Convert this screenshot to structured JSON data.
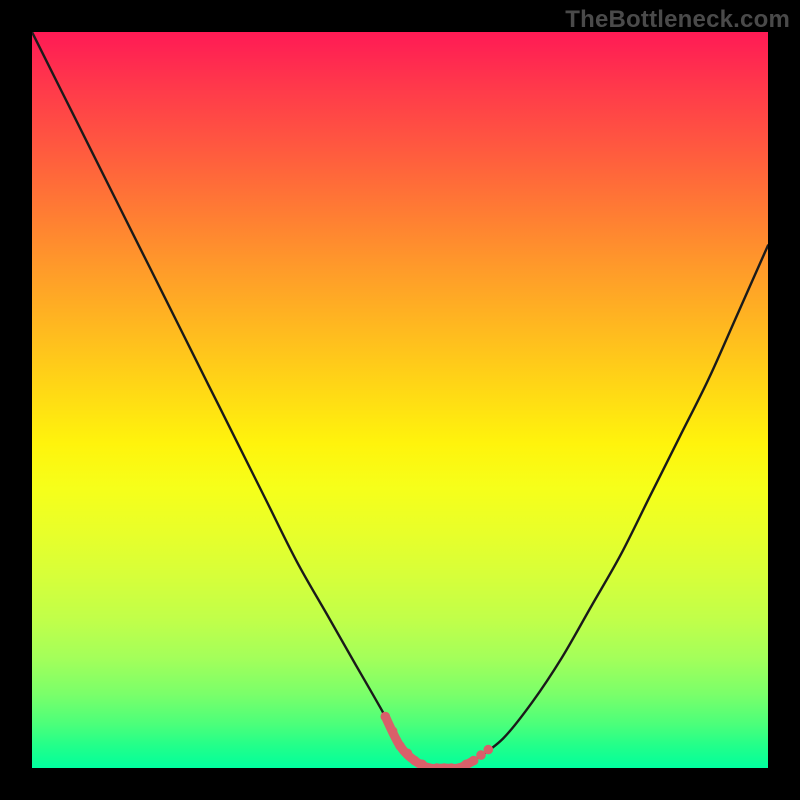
{
  "watermark": "TheBottleneck.com",
  "colors": {
    "frame": "#000000",
    "curve_stroke": "#1a1a1a",
    "lowband_marker": "#d9606a",
    "gradient_top": "#ff1a55",
    "gradient_bottom": "#00ffa0"
  },
  "chart_data": {
    "type": "line",
    "title": "",
    "xlabel": "",
    "ylabel": "",
    "xlim": [
      0,
      100
    ],
    "ylim": [
      0,
      100
    ],
    "grid": false,
    "legend": false,
    "series": [
      {
        "name": "bottleneck-curve",
        "x": [
          0,
          4,
          8,
          12,
          16,
          20,
          24,
          28,
          32,
          36,
          40,
          44,
          48,
          50,
          52,
          54,
          56,
          58,
          60,
          64,
          68,
          72,
          76,
          80,
          84,
          88,
          92,
          96,
          100
        ],
        "y": [
          100,
          92,
          84,
          76,
          68,
          60,
          52,
          44,
          36,
          28,
          21,
          14,
          7,
          3,
          1,
          0,
          0,
          0,
          1,
          4,
          9,
          15,
          22,
          29,
          37,
          45,
          53,
          62,
          71
        ]
      }
    ],
    "annotations": [
      {
        "name": "low-bottleneck-band",
        "x_range": [
          48,
          62
        ],
        "y": 1,
        "color": "#d9606a"
      }
    ]
  }
}
